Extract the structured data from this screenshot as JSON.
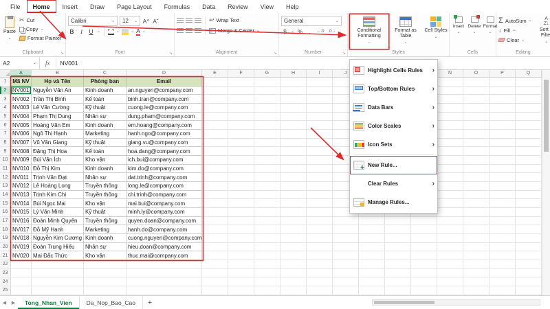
{
  "colors": {
    "annotation": "#e02b2b",
    "excel_green": "#107c41",
    "table_header_fill": "#d6e4bc"
  },
  "ribbon": {
    "tabs": [
      {
        "label": "File"
      },
      {
        "label": "Home",
        "selected": true,
        "annotated": true
      },
      {
        "label": "Insert"
      },
      {
        "label": "Draw"
      },
      {
        "label": "Page Layout"
      },
      {
        "label": "Formulas"
      },
      {
        "label": "Data"
      },
      {
        "label": "Review"
      },
      {
        "label": "View"
      },
      {
        "label": "Help"
      }
    ],
    "clipboard": {
      "group_label": "Clipboard",
      "paste": "Paste",
      "cut": "Cut",
      "copy": "Copy",
      "format_painter": "Format Painter"
    },
    "font": {
      "group_label": "Font",
      "font_name": "Calibri",
      "font_size": "12"
    },
    "alignment": {
      "group_label": "Alignment",
      "wrap_text": "Wrap Text",
      "merge_center": "Merge & Center"
    },
    "number": {
      "group_label": "Number",
      "format": "General"
    },
    "styles": {
      "group_label": "Styles",
      "conditional_formatting": "Conditional Formatting",
      "format_as_table": "Format as Table",
      "cell_styles": "Cell Styles"
    },
    "cells": {
      "group_label": "Cells",
      "insert": "Insert",
      "delete": "Delete",
      "format": "Format"
    },
    "editing": {
      "group_label": "Editing",
      "autosum": "AutoSum",
      "fill": "Fill",
      "clear": "Clear",
      "sort_filter": "Sort & Filter"
    }
  },
  "formula_bar": {
    "name_box": "A2",
    "formula": "NV001"
  },
  "cf_menu": {
    "items": [
      {
        "label": "Highlight Cells Rules",
        "icon": "highlight-cells-rules",
        "submenu": true
      },
      {
        "label": "Top/Bottom Rules",
        "icon": "top-bottom-rules",
        "submenu": true
      },
      {
        "label": "Data Bars",
        "icon": "data-bars",
        "submenu": true
      },
      {
        "label": "Color Scales",
        "icon": "color-scales",
        "submenu": true
      },
      {
        "label": "Icon Sets",
        "icon": "icon-sets",
        "submenu": true
      },
      {
        "label": "New Rule...",
        "icon": "new-rule",
        "submenu": false,
        "annotated": true
      },
      {
        "label": "Clear Rules",
        "icon": "none",
        "submenu": true
      },
      {
        "label": "Manage Rules...",
        "icon": "manage-rules",
        "submenu": false
      }
    ]
  },
  "grid": {
    "columns": [
      "A",
      "B",
      "C",
      "D",
      "E",
      "F",
      "G",
      "H",
      "I",
      "J",
      "K",
      "L",
      "M",
      "N",
      "O",
      "P",
      "Q"
    ],
    "visible_rows": 25,
    "active_cell": "A2",
    "table": {
      "headers": [
        "Mã NV",
        "Họ và Tên",
        "Phòng ban",
        "Email"
      ],
      "rows": [
        [
          "NV001",
          "Nguyễn Văn An",
          "Kinh doanh",
          "an.nguyen@company.com"
        ],
        [
          "NV002",
          "Trần Thị Bình",
          "Kế toán",
          "binh.tran@company.com"
        ],
        [
          "NV003",
          "Lê Văn Cường",
          "Kỹ thuật",
          "cuong.le@company.com"
        ],
        [
          "NV004",
          "Phạm Thị Dung",
          "Nhân sự",
          "dung.pham@company.com"
        ],
        [
          "NV005",
          "Hoàng Văn Em",
          "Kinh doanh",
          "em.hoang@company.com"
        ],
        [
          "NV006",
          "Ngô Thị Hạnh",
          "Marketing",
          "hanh.ngo@company.com"
        ],
        [
          "NV007",
          "Vũ Văn Giang",
          "Kỹ thuật",
          "giang.vu@company.com"
        ],
        [
          "NV008",
          "Đặng Thị Hoa",
          "Kế toán",
          "hoa.dang@company.com"
        ],
        [
          "NV009",
          "Bùi Văn Ích",
          "Kho vận",
          "ich.bui@company.com"
        ],
        [
          "NV010",
          "Đỗ Thị Kim",
          "Kinh doanh",
          "kim.do@company.com"
        ],
        [
          "NV011",
          "Trịnh Văn Đạt",
          "Nhân sự",
          "dat.trinh@company.com"
        ],
        [
          "NV012",
          "Lê Hoàng Long",
          "Truyền thông",
          "long.le@company.com"
        ],
        [
          "NV013",
          "Trịnh Kim Chi",
          "Truyền thông",
          "chi.trinh@company.com"
        ],
        [
          "NV014",
          "Bùi Ngọc Mai",
          "Kho vận",
          "mai.bui@company.com"
        ],
        [
          "NV015",
          "Lý Văn Minh",
          "Kỹ thuật",
          "minh.ly@company.com"
        ],
        [
          "NV016",
          "Đoàn Minh Quyên",
          "Truyền thông",
          "quyen.doan@company.com"
        ],
        [
          "NV017",
          "Đỗ Mỹ Hạnh",
          "Marketing",
          "hanh.do@company.com"
        ],
        [
          "NV018",
          "Nguyễn Kim Cương",
          "Kinh doanh",
          "cuong.nguyen@company.com"
        ],
        [
          "NV019",
          "Đoàn Trung Hiếu",
          "Nhân sự",
          "hieu.doan@company.com"
        ],
        [
          "NV020",
          "Mai Đắc Thức",
          "Kho vận",
          "thuc.mai@company.com"
        ]
      ]
    }
  },
  "sheet_tabs": {
    "tabs": [
      {
        "label": "Tong_Nhan_Vien",
        "active": true
      },
      {
        "label": "Da_Nop_Bao_Cao",
        "active": false
      }
    ],
    "add_label": "+"
  }
}
